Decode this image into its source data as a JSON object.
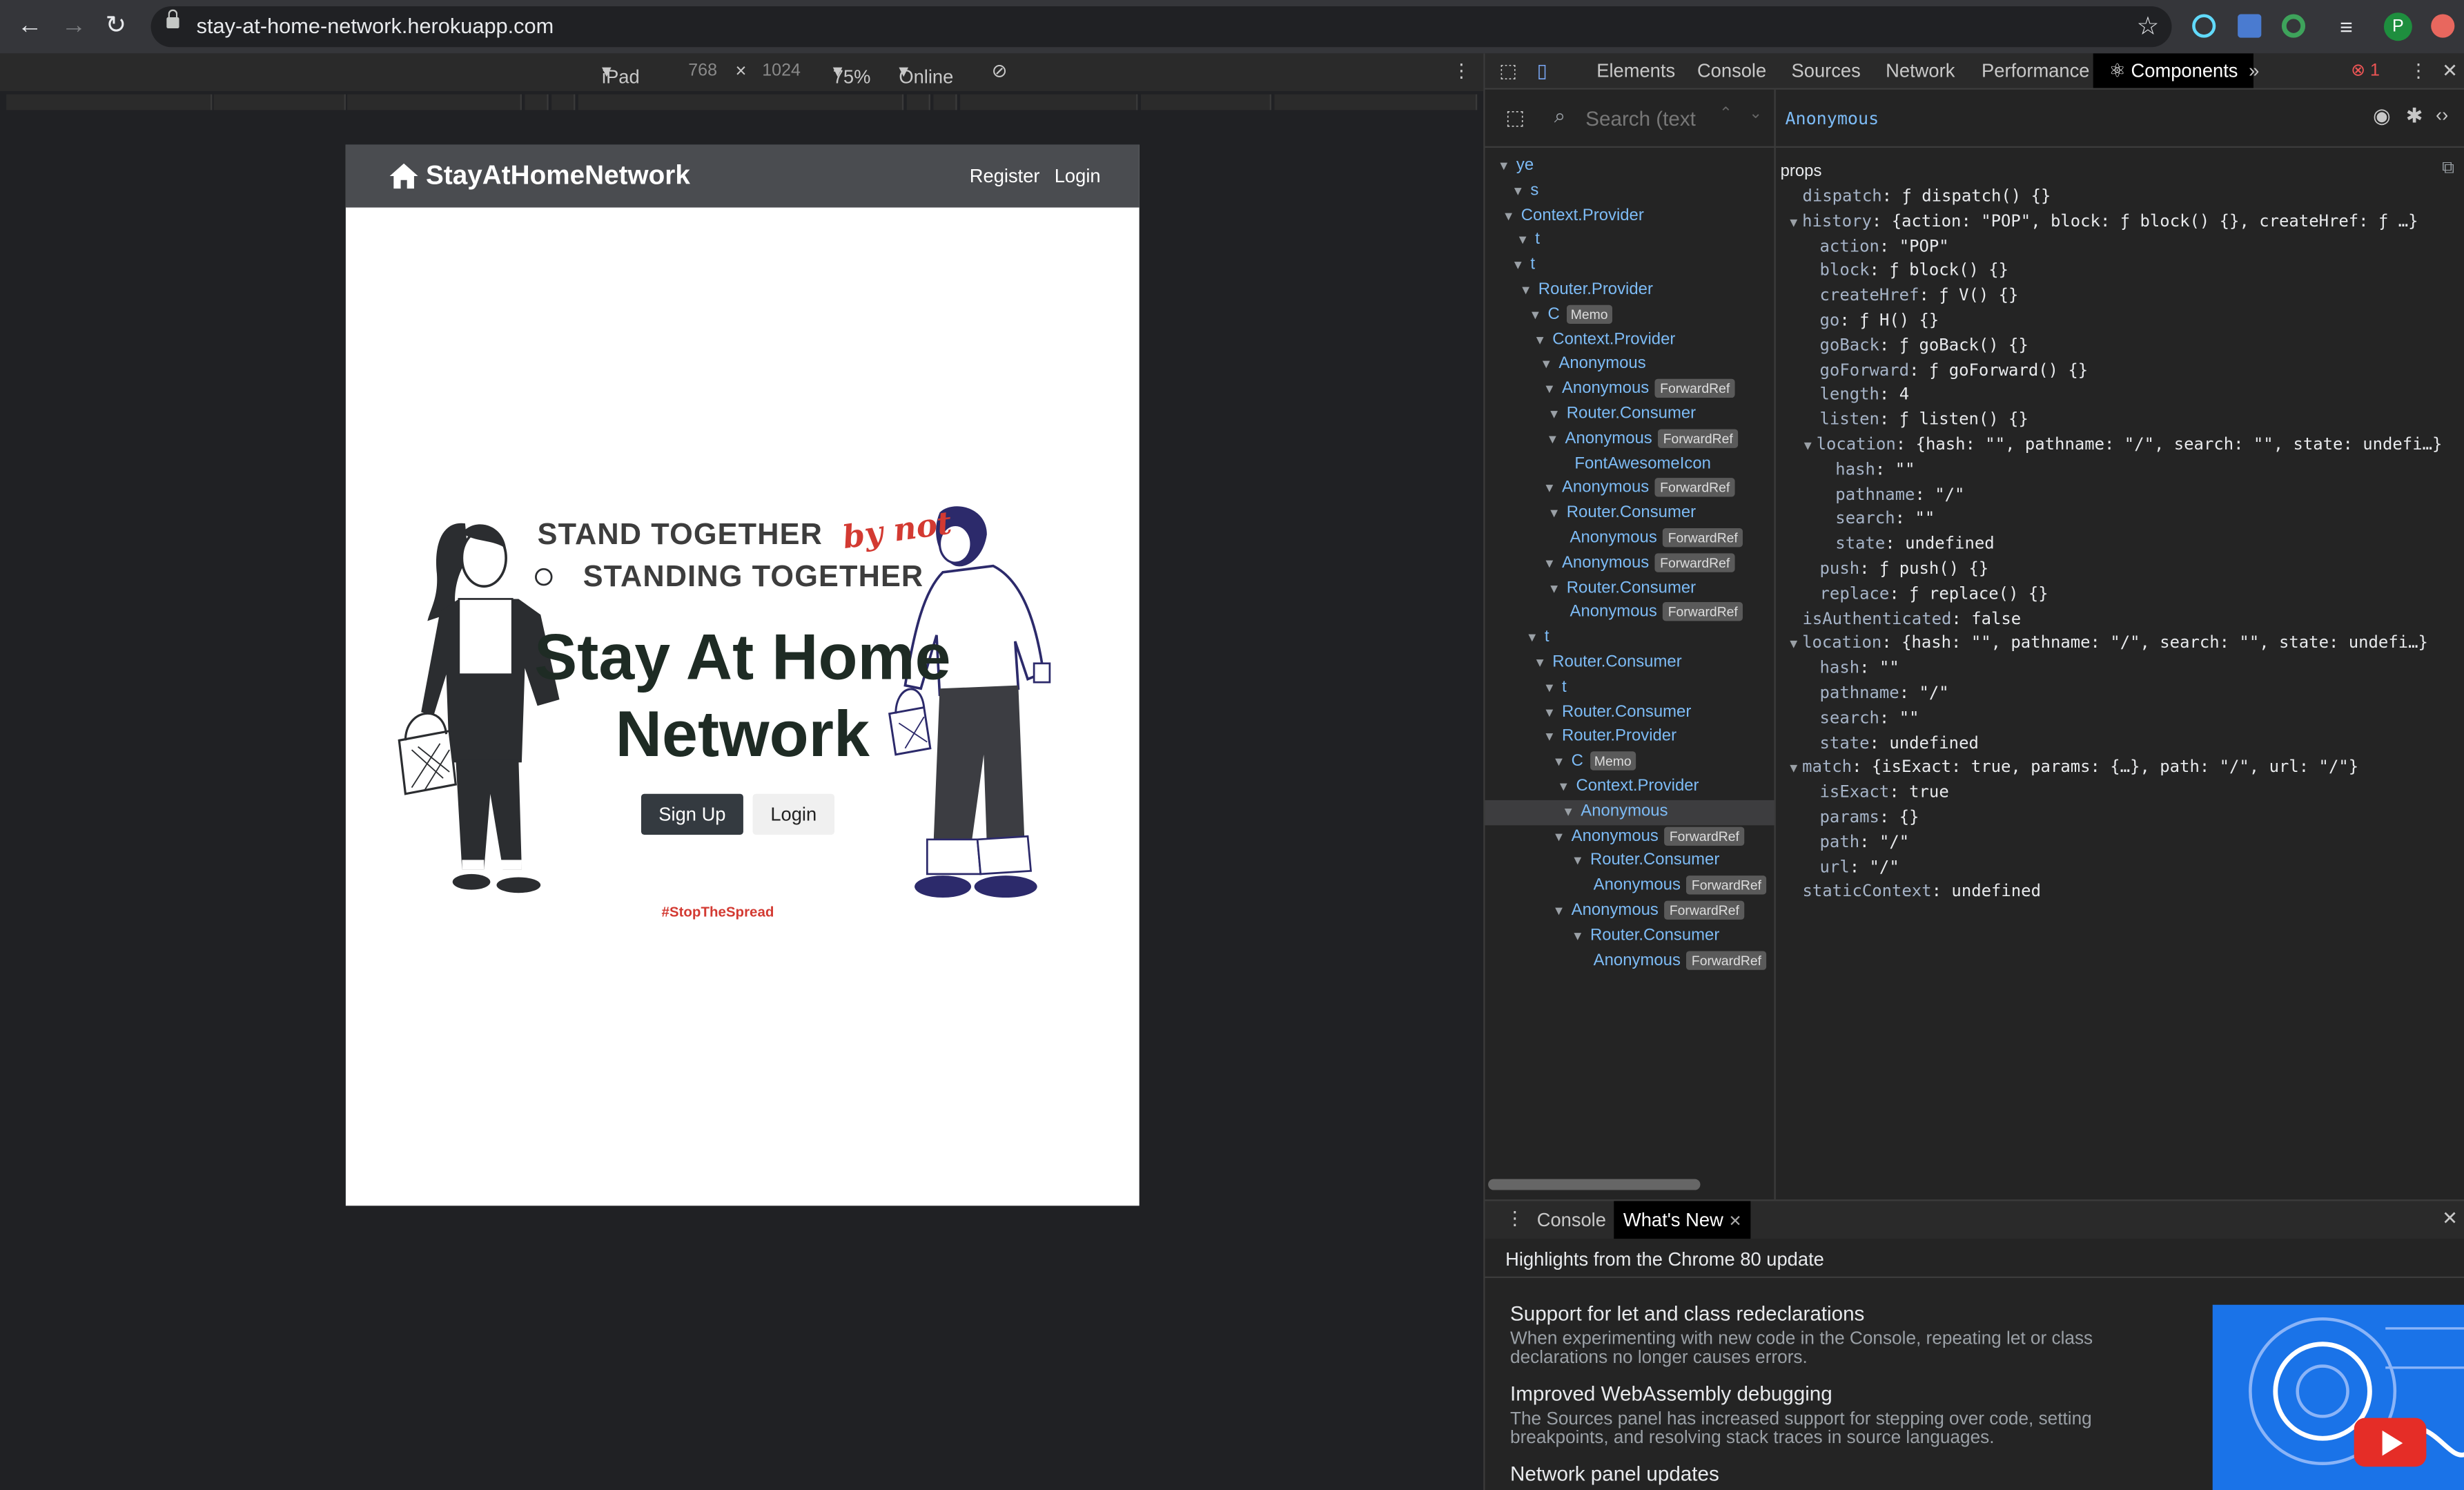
{
  "browser": {
    "url": "stay-at-home-network.herokuapp.com",
    "profile_initial": "P",
    "colors": {
      "toolbar": "#35363a",
      "avatar": "#1e8e3e"
    }
  },
  "device_toolbar": {
    "device": "iPad",
    "width": "768",
    "times": "×",
    "height": "1024",
    "zoom": "75%",
    "network": "Online"
  },
  "site": {
    "brand": "StayAtHomeNetwork",
    "nav_register": "Register",
    "nav_login": "Login",
    "tagline_line1": "STAND TOGETHER",
    "tagline_accent": "by not",
    "tagline_line2": "STANDING TOGETHER",
    "headline": "Stay At Home Network",
    "signup_label": "Sign Up",
    "login_label": "Login",
    "hashtag": "#StopTheSpread",
    "colors": {
      "nav": "#4a4c50",
      "accent": "#d33a32",
      "headline": "#1e2b24"
    }
  },
  "devtools": {
    "tabs": [
      "Elements",
      "Console",
      "Sources",
      "Network",
      "Performance"
    ],
    "active_tab": "Components",
    "error_count": "1",
    "search_placeholder": "Search (text",
    "selected_component": "Anonymous",
    "tree": [
      {
        "name": "ye",
        "badge": ""
      },
      {
        "name": "s",
        "badge": ""
      },
      {
        "name": "Context.Provider",
        "badge": ""
      },
      {
        "name": "t",
        "badge": ""
      },
      {
        "name": "t",
        "badge": ""
      },
      {
        "name": "Router.Provider",
        "badge": ""
      },
      {
        "name": "C",
        "badge": "Memo"
      },
      {
        "name": "Context.Provider",
        "badge": ""
      },
      {
        "name": "Anonymous",
        "badge": ""
      },
      {
        "name": "Anonymous",
        "badge": "ForwardRef"
      },
      {
        "name": "Router.Consumer",
        "badge": ""
      },
      {
        "name": "Anonymous",
        "badge": "ForwardRef"
      },
      {
        "name": "FontAwesomeIcon",
        "badge": ""
      },
      {
        "name": "Anonymous",
        "badge": "ForwardRef"
      },
      {
        "name": "Router.Consumer",
        "badge": ""
      },
      {
        "name": "Anonymous",
        "badge": "ForwardRef"
      },
      {
        "name": "Anonymous",
        "badge": "ForwardRef"
      },
      {
        "name": "Router.Consumer",
        "badge": ""
      },
      {
        "name": "Anonymous",
        "badge": "ForwardRef"
      },
      {
        "name": "t",
        "badge": ""
      },
      {
        "name": "Router.Consumer",
        "badge": ""
      },
      {
        "name": "t",
        "badge": ""
      },
      {
        "name": "Router.Consumer",
        "badge": ""
      },
      {
        "name": "Router.Provider",
        "badge": ""
      },
      {
        "name": "C",
        "badge": "Memo"
      },
      {
        "name": "Context.Provider",
        "badge": ""
      },
      {
        "name": "Anonymous",
        "badge": ""
      },
      {
        "name": "Anonymous",
        "badge": "ForwardRef"
      },
      {
        "name": "Router.Consumer",
        "badge": ""
      },
      {
        "name": "Anonymous",
        "badge": "ForwardRef"
      },
      {
        "name": "Anonymous",
        "badge": "ForwardRef"
      },
      {
        "name": "Router.Consumer",
        "badge": ""
      },
      {
        "name": "Anonymous",
        "badge": "ForwardRef"
      }
    ],
    "props_label": "props",
    "props": [
      {
        "key": "dispatch",
        "value": "ƒ dispatch() {}"
      },
      {
        "key": "history",
        "value": "{action: \"POP\", block: ƒ block() {}, createHref: ƒ …}"
      },
      {
        "key": "action",
        "value": "\"POP\""
      },
      {
        "key": "block",
        "value": "ƒ block() {}"
      },
      {
        "key": "createHref",
        "value": "ƒ V() {}"
      },
      {
        "key": "go",
        "value": "ƒ H() {}"
      },
      {
        "key": "goBack",
        "value": "ƒ goBack() {}"
      },
      {
        "key": "goForward",
        "value": "ƒ goForward() {}"
      },
      {
        "key": "length",
        "value": "4"
      },
      {
        "key": "listen",
        "value": "ƒ listen() {}"
      },
      {
        "key": "location",
        "value": "{hash: \"\", pathname: \"/\", search: \"\", state: undefi…}"
      },
      {
        "key": "hash",
        "value": "\"\""
      },
      {
        "key": "pathname",
        "value": "\"/\""
      },
      {
        "key": "search",
        "value": "\"\""
      },
      {
        "key": "state",
        "value": "undefined"
      },
      {
        "key": "push",
        "value": "ƒ push() {}"
      },
      {
        "key": "replace",
        "value": "ƒ replace() {}"
      },
      {
        "key": "isAuthenticated",
        "value": "false"
      },
      {
        "key": "location",
        "value": "{hash: \"\", pathname: \"/\", search: \"\", state: undefi…}"
      },
      {
        "key": "hash",
        "value": "\"\""
      },
      {
        "key": "pathname",
        "value": "\"/\""
      },
      {
        "key": "search",
        "value": "\"\""
      },
      {
        "key": "state",
        "value": "undefined"
      },
      {
        "key": "match",
        "value": "{isExact: true, params: {…}, path: \"/\", url: \"/\"}"
      },
      {
        "key": "isExact",
        "value": "true"
      },
      {
        "key": "params",
        "value": "{}"
      },
      {
        "key": "path",
        "value": "\"/\""
      },
      {
        "key": "url",
        "value": "\"/\""
      },
      {
        "key": "staticContext",
        "value": "undefined"
      }
    ],
    "drawer": {
      "tab_console": "Console",
      "tab_whats_new": "What's New",
      "highlights": "Highlights from the Chrome 80 update",
      "items": [
        {
          "title": "Support for let and class redeclarations",
          "desc": "When experimenting with new code in the Console, repeating let or class declarations no longer causes errors."
        },
        {
          "title": "Improved WebAssembly debugging",
          "desc": "The Sources panel has increased support for stepping over code, setting breakpoints, and resolving stack traces in source languages."
        },
        {
          "title": "Network panel updates",
          "desc": ""
        }
      ]
    }
  }
}
